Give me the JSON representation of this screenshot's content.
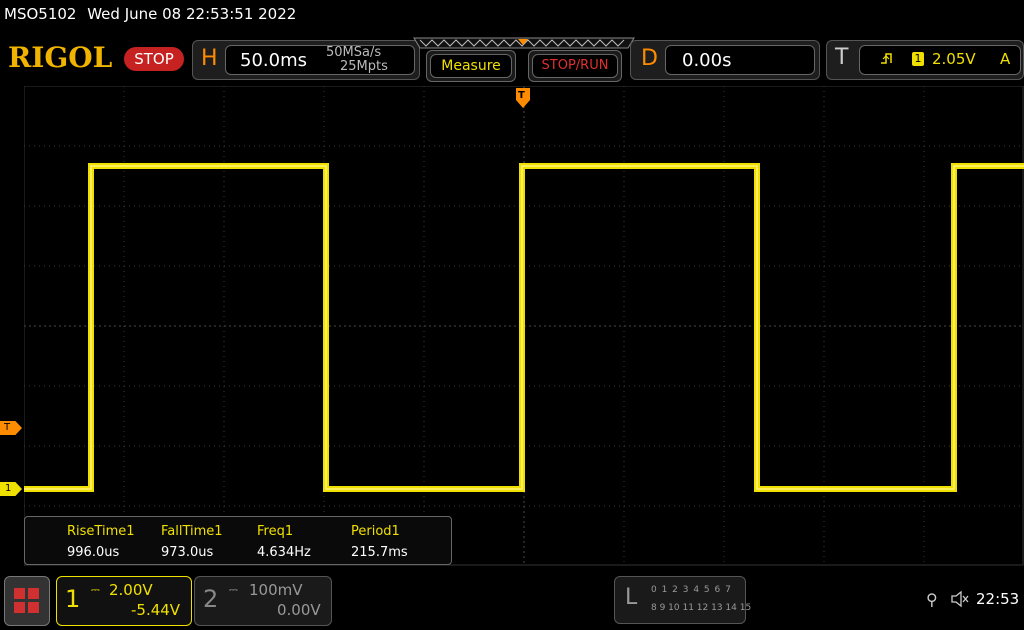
{
  "status": {
    "model": "MSO5102",
    "datetime": "Wed June 08 22:53:51 2022"
  },
  "brand": {
    "logo": "RIGOL",
    "run_state": "STOP"
  },
  "horizontal": {
    "letter": "H",
    "timebase": "50.0ms",
    "sample_rate": "50MSa/s",
    "memory_depth": "25Mpts"
  },
  "buttons": {
    "measure": "Measure",
    "stop_run": "STOP/RUN"
  },
  "delay": {
    "letter": "D",
    "value": "0.00s"
  },
  "trigger": {
    "letter": "T",
    "source": "1",
    "level": "2.05V",
    "mode": "A"
  },
  "markers": {
    "trigger_level": "T",
    "channel1_ground": "1"
  },
  "measurements": {
    "headers": [
      "RiseTime1",
      "FallTime1",
      "Freq1",
      "Period1"
    ],
    "values": [
      "996.0us",
      "973.0us",
      "4.634Hz",
      "215.7ms"
    ]
  },
  "channels": [
    {
      "number": "1",
      "scale": "2.00V",
      "offset": "-5.44V",
      "color": "#f0e000"
    },
    {
      "number": "2",
      "scale": "100mV",
      "offset": "0.00V",
      "color": "#aaaaaa"
    }
  ],
  "logic": {
    "letter": "L",
    "row1": "0 1 2 3  4 5 6 7",
    "row2": "8 9 10 11 12 13 14 15"
  },
  "system": {
    "clock": "22:53"
  },
  "colors": {
    "accent": "#ff8c00",
    "channel1": "#f0e000",
    "stop": "#c62222",
    "logo": "#f0b400"
  }
}
